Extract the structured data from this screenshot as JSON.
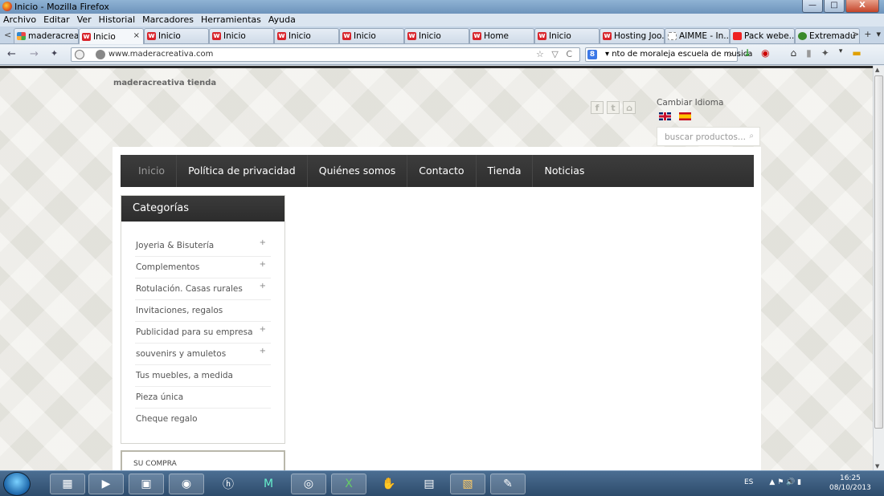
{
  "window": {
    "title": "Inicio - Mozilla Firefox",
    "controls": {
      "minimize": "—",
      "maximize": "□",
      "close": "X"
    }
  },
  "menubar": [
    "Archivo",
    "Editar",
    "Ver",
    "Historial",
    "Marcadores",
    "Herramientas",
    "Ayuda"
  ],
  "tabs": [
    {
      "label": "maderacrea...",
      "icon": "joomla-icon",
      "active": false
    },
    {
      "label": "Inicio",
      "icon": "w-icon",
      "active": true
    },
    {
      "label": "Inicio",
      "icon": "w-icon",
      "active": false
    },
    {
      "label": "Inicio",
      "icon": "w-icon",
      "active": false
    },
    {
      "label": "Inicio",
      "icon": "w-icon",
      "active": false
    },
    {
      "label": "Inicio",
      "icon": "w-icon",
      "active": false
    },
    {
      "label": "Inicio",
      "icon": "w-icon",
      "active": false
    },
    {
      "label": "Home",
      "icon": "w-icon",
      "active": false
    },
    {
      "label": "Inicio",
      "icon": "w-icon",
      "active": false
    },
    {
      "label": "Hosting Joo...",
      "icon": "w-icon",
      "active": false
    },
    {
      "label": "AIMME - In...",
      "icon": "blank-icon",
      "active": false
    },
    {
      "label": "Pack webe...",
      "icon": "youtube-icon",
      "active": false
    },
    {
      "label": "Extremadu",
      "icon": "tree-icon",
      "active": false
    }
  ],
  "tab_close_glyph": "×",
  "tab_nav": {
    "left": "<",
    "right": ">",
    "new": "+",
    "list": "▾"
  },
  "navbar": {
    "back": "←",
    "forward": "→",
    "url": "www.maderacreativa.com",
    "url_icons": "☆ ▽ C",
    "search_engine_letter": "8",
    "search_query": "▾ nto de moraleja escuela de musica",
    "search_icon": "⌕",
    "right_icons": [
      "↓",
      "◉",
      "⌂",
      "▮",
      "✦",
      "▾",
      "▬"
    ]
  },
  "page": {
    "site_name": "maderacreativa tienda",
    "social": [
      "f",
      "t",
      "⌂"
    ],
    "language_label": "Cambiar Idioma",
    "search_placeholder": "buscar productos...",
    "search_icon": "⌕",
    "nav": [
      "Inicio",
      "Política de privacidad",
      "Quiénes somos",
      "Contacto",
      "Tienda",
      "Noticias"
    ],
    "categories_title": "Categorías",
    "categories": [
      {
        "label": "Joyeria & Bisutería",
        "has_children": true
      },
      {
        "label": "Complementos",
        "has_children": true
      },
      {
        "label": "Rotulación. Casas rurales",
        "has_children": true
      },
      {
        "label": "Invitaciones, regalos",
        "has_children": false
      },
      {
        "label": "Publicidad para su empresa",
        "has_children": true
      },
      {
        "label": "souvenirs y amuletos",
        "has_children": true
      },
      {
        "label": "Tus muebles, a medida",
        "has_children": false
      },
      {
        "label": "Pieza única",
        "has_children": false
      },
      {
        "label": "Cheque regalo",
        "has_children": false
      }
    ],
    "expand_glyph": "+",
    "cart_title": "SU COMPRA"
  },
  "taskbar": {
    "language": "ES",
    "time": "16:25",
    "date": "08/10/2013",
    "tray_icons": "▲  ⚑  🔊  ▮"
  },
  "colors": {
    "nav_bg": "#333333",
    "nav_active_text": "#999999",
    "accent_red": "#d8242b"
  }
}
